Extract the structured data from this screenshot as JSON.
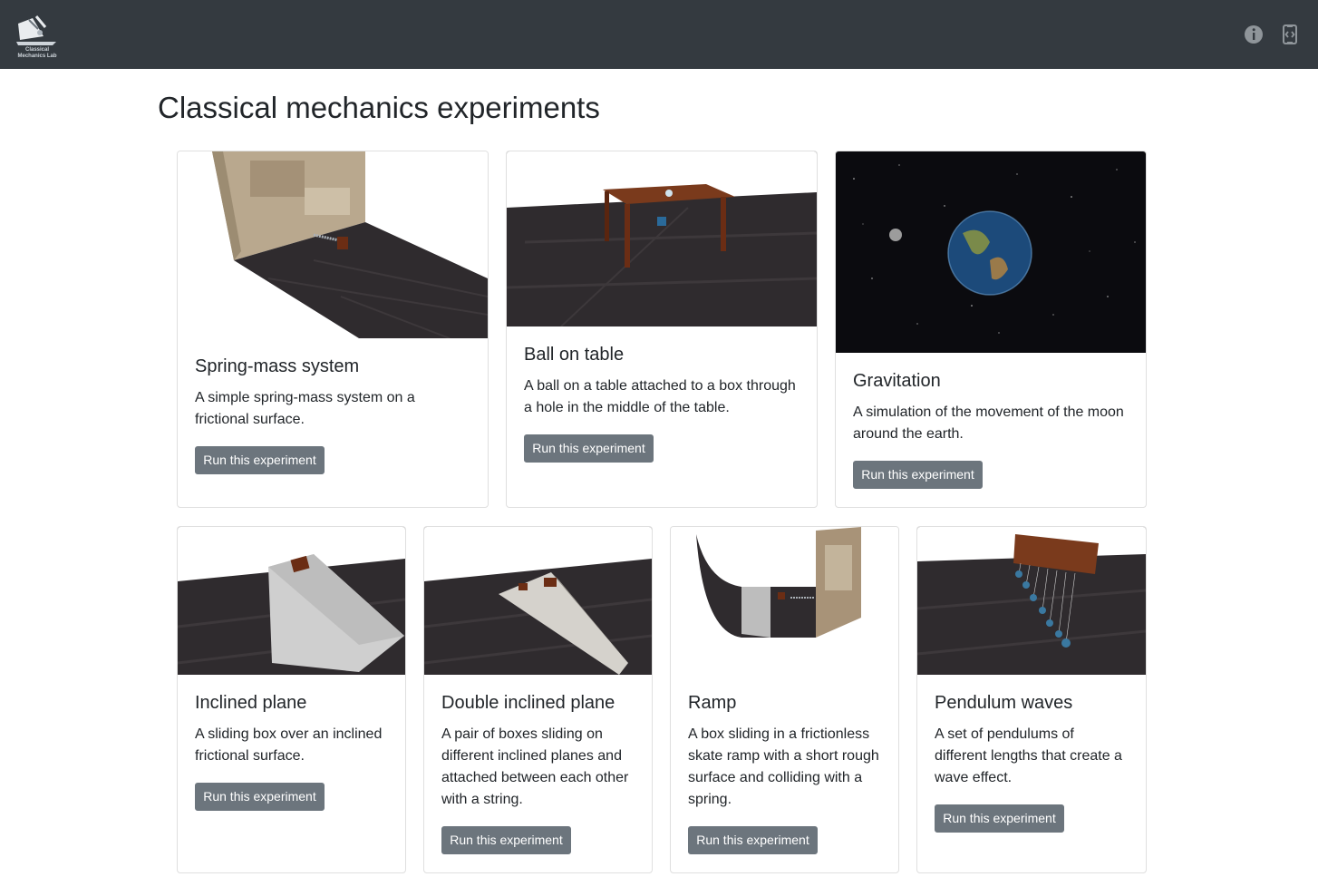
{
  "navbar": {
    "logo_text": "Classical Mechanics Lab",
    "info_icon": "info-circle-icon",
    "code_icon": "code-file-icon"
  },
  "page": {
    "title": "Classical mechanics experiments"
  },
  "experiments": [
    {
      "title": "Spring-mass system",
      "description": "A simple spring-mass system on a frictional surface.",
      "button": "Run this experiment"
    },
    {
      "title": "Ball on table",
      "description": "A ball on a table attached to a box through a hole in the middle of the table.",
      "button": "Run this experiment"
    },
    {
      "title": "Gravitation",
      "description": "A simulation of the movement of the moon around the earth.",
      "button": "Run this experiment"
    },
    {
      "title": "Inclined plane",
      "description": "A sliding box over an inclined frictional surface.",
      "button": "Run this experiment"
    },
    {
      "title": "Double inclined plane",
      "description": "A pair of boxes sliding on different inclined planes and attached between each other with a string.",
      "button": "Run this experiment"
    },
    {
      "title": "Ramp",
      "description": "A box sliding in a frictionless skate ramp with a short rough surface and colliding with a spring.",
      "button": "Run this experiment"
    },
    {
      "title": "Pendulum waves",
      "description": "A set of pendulums of different lengths that create a wave effect.",
      "button": "Run this experiment"
    }
  ],
  "colors": {
    "navbar": "#343a40",
    "button": "#6c757d",
    "floor": "#2f2b2e",
    "space": "#0b0b0f"
  }
}
